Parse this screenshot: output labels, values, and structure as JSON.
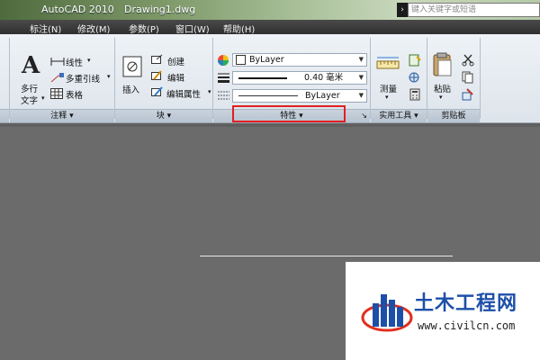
{
  "titlebar": {
    "app_name": "AutoCAD 2010",
    "document": "Drawing1.dwg",
    "search_placeholder": "键入关键字或短语"
  },
  "menubar": {
    "items": [
      "标注(N)",
      "修改(M)",
      "参数(P)",
      "窗口(W)",
      "帮助(H)"
    ]
  },
  "ribbon": {
    "annotation": {
      "title": "注释",
      "multiline_text_l1": "多行",
      "multiline_text_l2": "文字",
      "linear": "线性",
      "multileader": "多重引线",
      "table": "表格"
    },
    "block": {
      "title": "块",
      "insert": "插入",
      "create": "创建",
      "edit": "编辑",
      "edit_attributes": "编辑属性"
    },
    "properties": {
      "title": "特性",
      "color_value": "ByLayer",
      "lineweight_value": "0.40 毫米",
      "linetype_value": "ByLayer"
    },
    "utilities": {
      "title": "实用工具",
      "measure": "测量"
    },
    "clipboard": {
      "title": "剪贴板",
      "paste": "粘贴"
    }
  },
  "watermark": {
    "site_name": "土木工程网",
    "url": "www.civilcn.com"
  }
}
